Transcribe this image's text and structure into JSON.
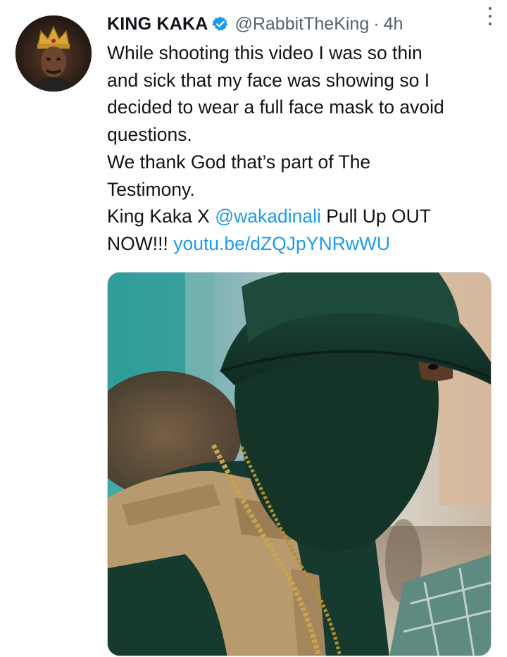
{
  "tweet": {
    "author_name": "KING KAKA",
    "author_handle": "@RabbitTheKing",
    "separator": "·",
    "time": "4h",
    "verified": true,
    "body_lines": {
      "l1": "While shooting this video I was so thin",
      "l2": "and sick that my face was showing so I",
      "l3": "decided to wear a full face mask to avoid",
      "l4": "questions.",
      "l5": "We thank God that’s part of The",
      "l6": "Testimony.",
      "l7_prefix": "King Kaka X ",
      "l7_mention": "@wakadinali",
      "l7_suffix": " Pull Up OUT",
      "l8_prefix": "NOW!!! ",
      "l8_link": "youtu.be/dZQJpYNRwWU"
    }
  },
  "icons": {
    "verified": "verified-badge-icon",
    "more": "more-options-icon"
  },
  "colors": {
    "link": "#1d9bf0",
    "secondary_text": "#536471",
    "primary_text": "#0f1419",
    "verified": "#1d9bf0"
  }
}
